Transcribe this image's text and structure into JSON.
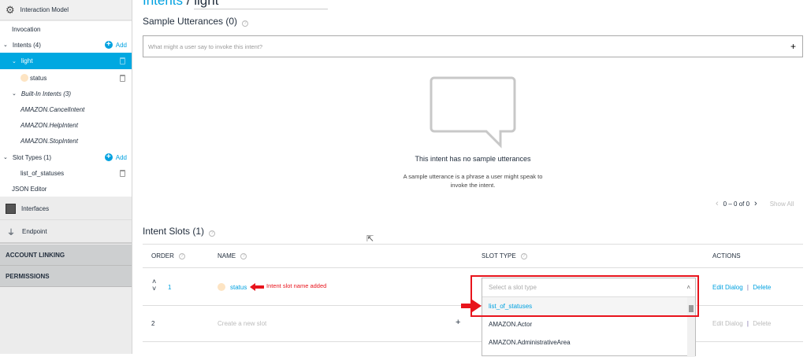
{
  "sidebar": {
    "interaction_model": "Interaction Model",
    "invocation": "Invocation",
    "intents": "Intents (4)",
    "add": "Add",
    "light": "light",
    "status": "status",
    "builtin": "Built-In Intents (3)",
    "builtin_items": [
      "AMAZON.CancelIntent",
      "AMAZON.HelpIntent",
      "AMAZON.StopIntent"
    ],
    "slot_types": "Slot Types (1)",
    "slot_type_item": "list_of_statuses",
    "json_editor": "JSON Editor",
    "interfaces": "Interfaces",
    "endpoint": "Endpoint",
    "account_linking": "ACCOUNT LINKING",
    "permissions": "PERMISSIONS"
  },
  "breadcrumb": {
    "intents": "Intents",
    "sep": "/",
    "current": "light"
  },
  "utterances": {
    "title": "Sample Utterances (0)",
    "placeholder": "What might a user say to invoke this intent?",
    "add": "+",
    "empty_title": "This intent has no sample utterances",
    "empty_desc_1": "A sample utterance is a phrase a user might speak to",
    "empty_desc_2": "invoke the intent.",
    "pagination": "0 – 0 of 0",
    "show_all": "Show All"
  },
  "slots": {
    "title": "Intent Slots (1)",
    "headers": {
      "order": "ORDER",
      "name": "NAME",
      "slot_type": "SLOT TYPE",
      "actions": "ACTIONS"
    },
    "rows": [
      {
        "order": "1",
        "name": "status",
        "edit": "Edit Dialog",
        "sep": "|",
        "delete": "Delete"
      },
      {
        "order": "2",
        "placeholder": "Create a new slot",
        "add": "+",
        "edit": "Edit Dialog",
        "sep": "|",
        "delete": "Delete"
      }
    ],
    "annotation": "Intent slot name added",
    "dropdown": {
      "placeholder": "Select a slot type",
      "options": [
        "list_of_statuses",
        "AMAZON.Actor",
        "AMAZON.AdministrativeArea"
      ]
    }
  },
  "colors": {
    "accent": "#00a1e0",
    "annotation": "#e8141c"
  }
}
